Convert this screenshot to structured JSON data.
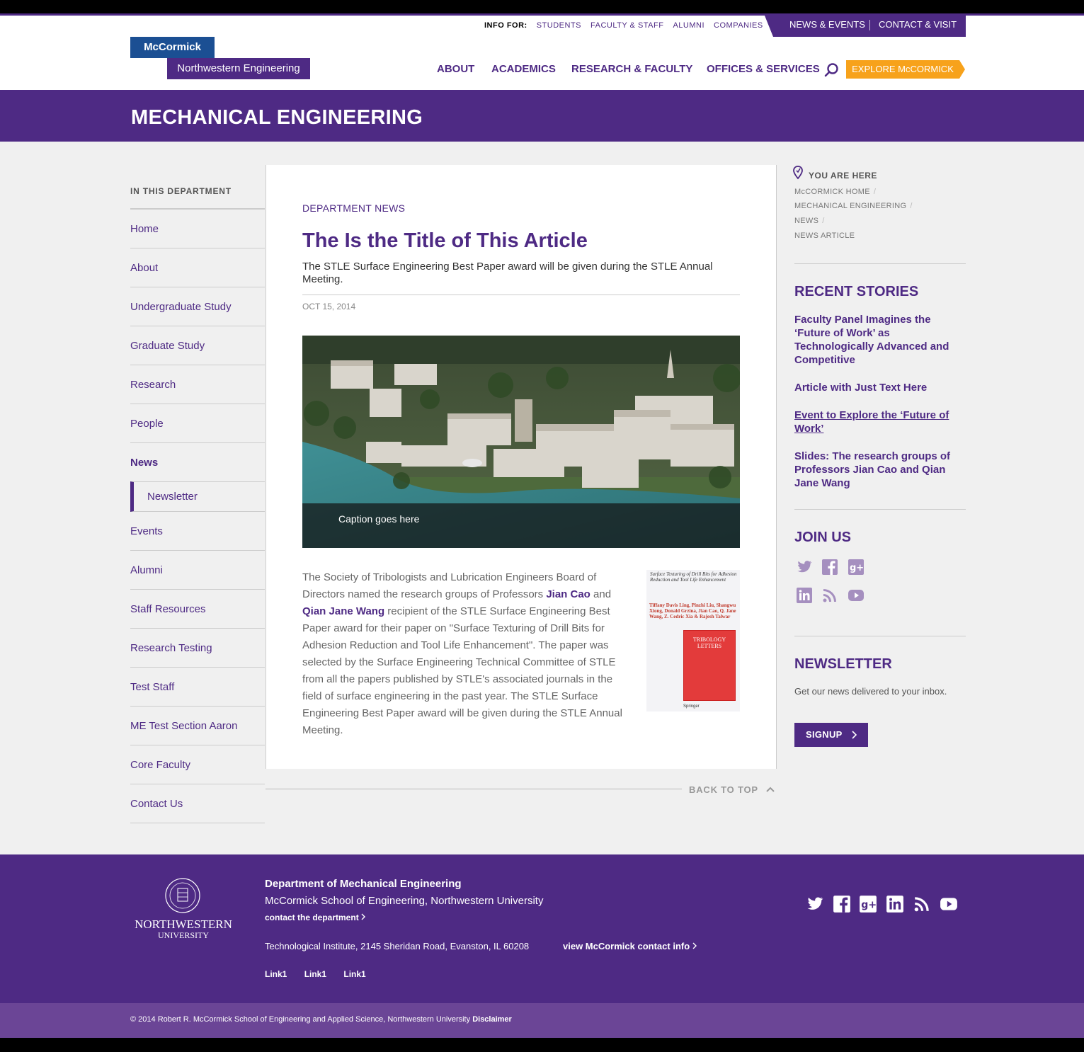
{
  "header": {
    "logo_top": "McCormick",
    "logo_bottom": "Northwestern Engineering",
    "info_for_label": "INFO FOR:",
    "info_for": [
      "STUDENTS",
      "FACULTY & STAFF",
      "ALUMNI",
      "COMPANIES"
    ],
    "news_events": "NEWS & EVENTS",
    "contact_visit": "CONTACT & VISIT",
    "nav": [
      "ABOUT",
      "ACADEMICS",
      "RESEARCH & FACULTY",
      "OFFICES & SERVICES"
    ],
    "explore": "EXPLORE McCORMICK"
  },
  "banner": {
    "title": "MECHANICAL ENGINEERING"
  },
  "leftnav": {
    "heading": "IN THIS DEPARTMENT",
    "items": [
      "Home",
      "About",
      "Undergraduate Study",
      "Graduate Study",
      "Research",
      "People",
      "News",
      "Newsletter",
      "Events",
      "Alumni",
      "Staff Resources",
      "Research Testing",
      "Test Staff",
      "ME Test Section Aaron",
      "Core Faculty",
      "Contact Us"
    ]
  },
  "article": {
    "kicker": "DEPARTMENT NEWS",
    "title": "The Is the Title of This Article",
    "subhead": "The STLE Surface Engineering Best Paper award will be given during the STLE Annual Meeting.",
    "date": "OCT 15, 2014",
    "caption": "Caption goes here",
    "body_1": "The Society of Tribologists and Lubrication Engineers Board of Directors named the research groups of Professors ",
    "name_1": "Jian Cao",
    "body_2": " and ",
    "name_2": "Qian Jane Wang",
    "body_3": " recipient of the STLE Surface Engineering Best Paper award for their paper on \"Surface Texturing of Drill Bits for Adhesion Reduction and Tool Life Enhancement\".  The paper was selected by the Surface Engineering Technical Committee of  STLE from all the papers published by STLE's associated journals in the field of surface engineering in the past year. The STLE Surface Engineering Best Paper award will be given during the STLE Annual Meeting.",
    "cover_title": "Surface Texturing of Drill Bits for Adhesion Reduction and Tool Life Enhancement",
    "cover_authors": "Tiffany Davis Ling, Pinzhi Liu, Shangwu Xiong, Donald Grzina, Jian Cao, Q. Jane Wang, Z. Cedric Xia & Rajesh Talwar",
    "cover_journal": "TRIBOLOGY LETTERS",
    "cover_publisher": "Springer",
    "back_to_top": "BACK TO TOP"
  },
  "sidebar": {
    "you_are_here": "YOU ARE HERE",
    "breadcrumbs": [
      "McCORMICK HOME",
      "MECHANICAL ENGINEERING",
      "NEWS",
      "NEWS ARTICLE"
    ],
    "recent_heading": "RECENT STORIES",
    "stories": [
      "Faculty Panel Imagines the ‘Future of Work’ as Technologically Advanced and Competitive",
      "Article with Just Text Here",
      "Event to Explore the ‘Future of Work’",
      "Slides: The research groups of Professors Jian Cao and Qian Jane Wang"
    ],
    "join_heading": "JOIN US",
    "newsletter_heading": "NEWSLETTER",
    "newsletter_text": "Get our news delivered to your inbox.",
    "signup": "SIGNUP"
  },
  "footer": {
    "nu_name": "NORTHWESTERN",
    "nu_sub": "UNIVERSITY",
    "dept": "Department of Mechanical Engineering",
    "school": "McCormick School of Engineering, Northwestern University",
    "contact": "contact the department",
    "address": "Technological Institute, 2145 Sheridan Road, Evanston, IL 60208",
    "view_contact": "view McCormick contact info",
    "links": [
      "Link1",
      "Link1",
      "Link1"
    ],
    "copyright": "© 2014 Robert R. McCormick School of Engineering and Applied Science, Northwestern University",
    "disclaimer": "Disclaimer"
  },
  "colors": {
    "purple": "#4e2a84",
    "orange": "#f7a21b",
    "blue": "#1b4f93"
  }
}
